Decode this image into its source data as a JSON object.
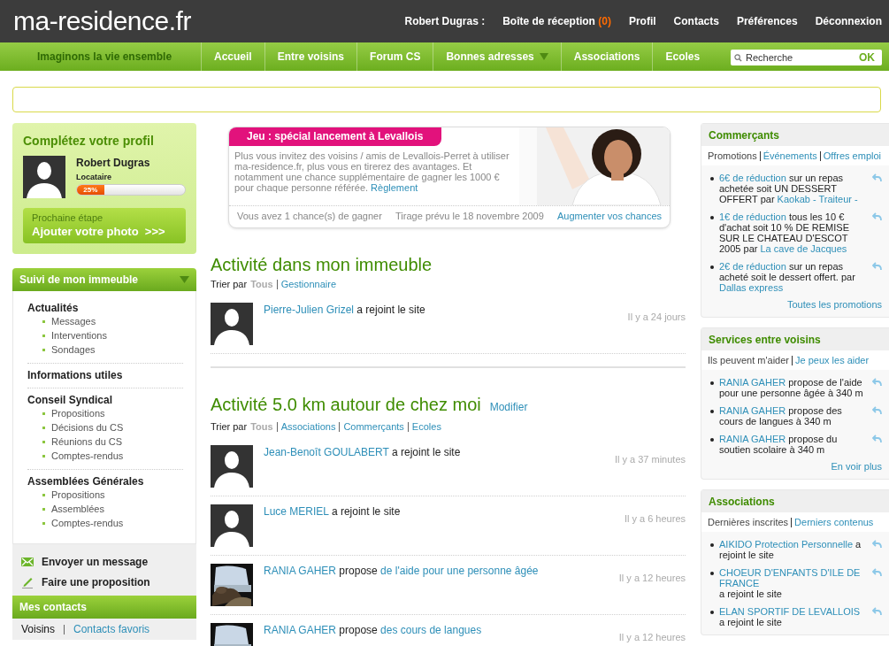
{
  "header": {
    "logo": "ma-residence.fr",
    "user": "Robert Dugras :",
    "links": [
      {
        "label": "Boîte de réception",
        "count": "(0)"
      },
      {
        "label": "Profil"
      },
      {
        "label": "Contacts"
      },
      {
        "label": "Préférences"
      },
      {
        "label": "Déconnexion"
      }
    ]
  },
  "navbar": {
    "tagline": "Imaginons la vie ensemble",
    "items": [
      {
        "label": "Accueil",
        "has_menu": false
      },
      {
        "label": "Entre voisins",
        "has_menu": false
      },
      {
        "label": "Forum CS",
        "has_menu": false
      },
      {
        "label": "Bonnes adresses",
        "has_menu": true
      },
      {
        "label": "Associations",
        "has_menu": false
      },
      {
        "label": "Ecoles",
        "has_menu": false
      }
    ],
    "search": {
      "placeholder": "Recherche",
      "button": "OK"
    }
  },
  "profile": {
    "title": "Complétez votre profil",
    "name": "Robert Dugras",
    "role": "Locataire",
    "level": 0.25,
    "reading": "25%",
    "next_step_label": "Prochaine étape",
    "next_step": "Ajouter votre photo  >>>"
  },
  "building_menu": {
    "title": "Suivi de mon immeuble",
    "groups": [
      {
        "title": "Actualités",
        "children": [
          "Messages",
          "Interventions",
          "Sondages"
        ]
      },
      {
        "title": "Informations utiles"
      },
      {
        "title": "Conseil Syndical",
        "children": [
          "Propositions",
          "Décisions du CS",
          "Réunions du CS",
          "Comptes-rendus"
        ]
      },
      {
        "title": "Assemblées Générales",
        "children": [
          "Propositions",
          "Assemblées",
          "Comptes-rendus"
        ]
      }
    ]
  },
  "actions": [
    {
      "kind": "message",
      "label": "Envoyer un message"
    },
    {
      "kind": "proposal",
      "label": "Faire une proposition"
    }
  ],
  "contacts": {
    "title": "Mes contacts",
    "tabs": [
      {
        "label": "Voisins",
        "selected": true
      },
      {
        "label": "Contacts favoris",
        "selected": false
      }
    ]
  },
  "banner": {
    "title": "Jeu : spécial lancement à Levallois",
    "text": "Plus vous invitez des voisins / amis de Levallois-Perret à utiliser ma-residence.fr, plus vous en tirerez des avantages. Et notamment une chance supplémentaire de gagner les 1000 € pour chaque personne référée. ",
    "rules_link": "Règlement",
    "chances": "Vous avez 1 chance(s) de gagner",
    "draw": "Tirage prévu le 18 novembre 2009",
    "more": "Augmenter vos chances"
  },
  "sections": [
    {
      "title": "Activité dans mon immeuble",
      "sort_label": "Trier par",
      "sort": [
        {
          "label": "Tous",
          "selected": true
        },
        {
          "label": "Gestionnaire",
          "selected": false
        }
      ],
      "rows": [
        {
          "kind": "silhouette",
          "name": "Pierre-Julien Grizel",
          "text": " a rejoint le site",
          "time": "Il y a 24 jours"
        }
      ]
    },
    {
      "title": "Activité 5.0 km autour de chez moi",
      "edit": "Modifier",
      "sort_label": "Trier par",
      "sort": [
        {
          "label": "Tous",
          "selected": true
        },
        {
          "label": "Associations",
          "selected": false
        },
        {
          "label": "Commerçants",
          "selected": false
        },
        {
          "label": "Ecoles",
          "selected": false
        }
      ],
      "rows": [
        {
          "kind": "silhouette",
          "name": "Jean-Benoît GOULABERT",
          "text": " a rejoint le site",
          "time": "Il y a 37 minutes"
        },
        {
          "kind": "silhouette",
          "name": "Luce MERIEL",
          "text": " a rejoint le site",
          "time": "Il y a 6 heures"
        },
        {
          "kind": "picture",
          "name": "RANIA GAHER",
          "text": " propose ",
          "target": "de l'aide pour une personne âgée",
          "time": "Il y a 12 heures"
        },
        {
          "kind": "picture",
          "name": "RANIA GAHER",
          "text": " propose ",
          "target": "des cours de langues",
          "time": "Il y a 12 heures"
        }
      ]
    }
  ],
  "panels": [
    {
      "title": "Commerçants",
      "tabs": [
        {
          "label": "Promotions",
          "selected": true
        },
        {
          "label": "Événements",
          "selected": false
        },
        {
          "label": "Offres emploi",
          "selected": false
        }
      ],
      "items": [
        {
          "name": "6€ de réduction",
          "text": " sur un repas achetée soit UN DESSERT OFFERT par ",
          "target": "Kaokab - Traiteur -"
        },
        {
          "name": "1€ de réduction",
          "text": " tous les 10 € d'achat soit 10 % DE REMISE SUR LE CHATEAU D'ESCOT 2005 par ",
          "target": "La cave de Jacques"
        },
        {
          "name": "2€ de réduction",
          "text": " sur un repas acheté soit le dessert offert. par ",
          "target": "Dallas express"
        }
      ],
      "footer": "Toutes les promotions"
    },
    {
      "title": "Services entre voisins",
      "tabs": [
        {
          "label": "Ils peuvent m'aider",
          "selected": true
        },
        {
          "label": "Je peux les aider",
          "selected": false
        }
      ],
      "items": [
        {
          "name": "RANIA GAHER",
          "text": " propose de l'aide pour une personne âgée à 340 m"
        },
        {
          "name": "RANIA GAHER",
          "text": " propose des cours de langues à 340 m"
        },
        {
          "name": "RANIA GAHER",
          "text": " propose du soutien scolaire à 340 m"
        }
      ],
      "footer": "En voir plus"
    },
    {
      "title": "Associations",
      "tabs": [
        {
          "label": "Dernières inscrites",
          "selected": true
        },
        {
          "label": "Derniers contenus",
          "selected": false
        }
      ],
      "items": [
        {
          "name": "AIKIDO Protection Personnelle",
          "text": " a rejoint le site"
        },
        {
          "name": "CHOEUR D'ENFANTS D'ILE DE FRANCE",
          "text": " a rejoint le site"
        },
        {
          "name": "ELAN SPORTIF DE LEVALLOIS",
          "text": " a rejoint le site"
        }
      ]
    }
  ]
}
